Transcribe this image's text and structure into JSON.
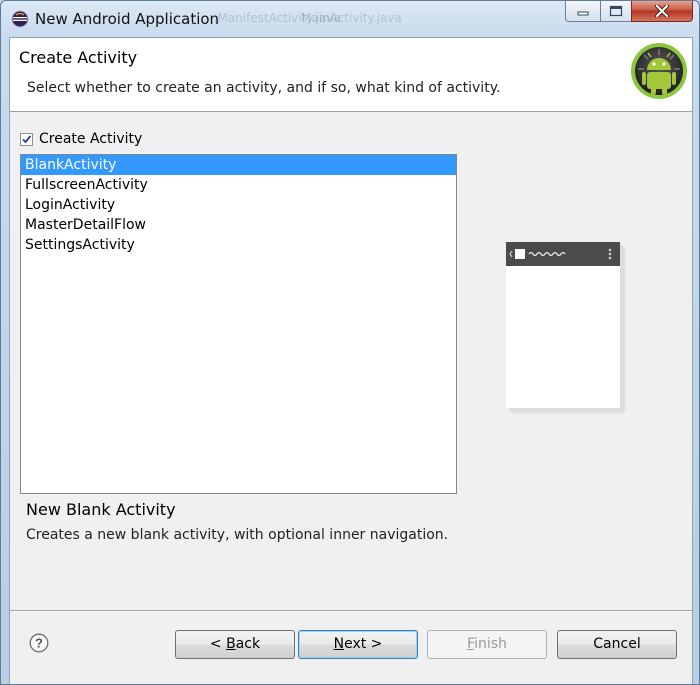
{
  "window": {
    "title": "New Android Application",
    "background_tabs": [
      "...ManifestActivity.java",
      "MainActivity.java"
    ]
  },
  "header": {
    "title": "Create Activity",
    "description": "Select whether to create an activity, and if so, what kind of activity.",
    "logo_icon": "android-logo-icon"
  },
  "create_activity": {
    "label": "Create Activity",
    "checked": true
  },
  "activity_list": {
    "items": [
      "BlankActivity",
      "FullscreenActivity",
      "LoginActivity",
      "MasterDetailFlow",
      "SettingsActivity"
    ],
    "selected": "BlankActivity"
  },
  "detail": {
    "title": "New Blank Activity",
    "description": "Creates a new blank activity, with optional inner navigation."
  },
  "buttons": {
    "back_prefix": "< ",
    "back_mnemonic": "B",
    "back_rest": "ack",
    "next_mnemonic": "N",
    "next_rest": "ext >",
    "finish_mnemonic": "F",
    "finish_rest": "inish",
    "cancel": "Cancel"
  },
  "colors": {
    "selection": "#3399ff",
    "android_green": "#a4c639"
  }
}
